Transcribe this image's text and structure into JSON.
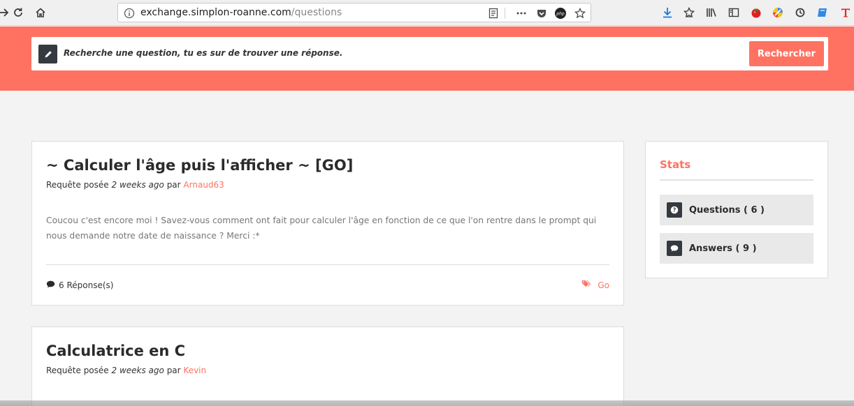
{
  "browser": {
    "url_host": "exchange.simplon-roanne.com",
    "url_path": "/questions"
  },
  "search": {
    "placeholder": "Recherche une question, tu es sur de trouver une réponse.",
    "button_label": "Rechercher"
  },
  "questions": [
    {
      "title": "~ Calculer l'âge puis l'afficher ~ [GO]",
      "meta_prefix": "Requête posée",
      "time": "2 weeks ago",
      "by": "par",
      "author": "Arnaud63",
      "body": "Coucou c'est encore moi ! Savez-vous comment ont fait pour calculer l'âge en fonction de ce que l'on rentre dans le prompt qui nous demande notre date de naissance ? Merci :*",
      "answers": "6 Réponse(s)",
      "tag": "Go"
    },
    {
      "title": "Calculatrice en C",
      "meta_prefix": "Requête posée",
      "time": "2 weeks ago",
      "by": "par",
      "author": "Kevin"
    }
  ],
  "stats": {
    "title": "Stats",
    "questions_label": "Questions ( 6 )",
    "answers_label": "Answers ( 9 )"
  },
  "colors": {
    "accent": "#ff7262",
    "dark": "#343a40"
  }
}
